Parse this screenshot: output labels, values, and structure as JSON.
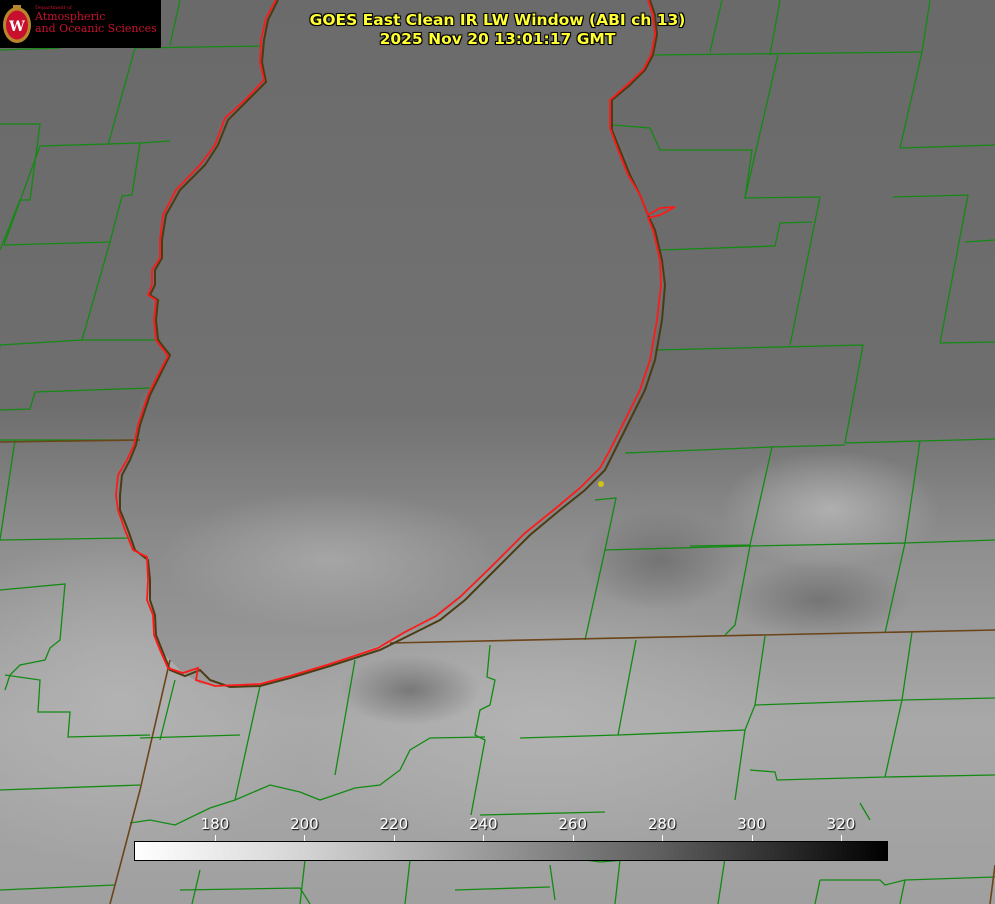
{
  "title": {
    "line1": "GOES East Clean IR LW Window (ABI ch 13)",
    "line2": "2025 Nov 20 13:01:17 GMT"
  },
  "logo": {
    "department": "Department of",
    "line1": "Atmospheric",
    "line2": "and Oceanic Sciences",
    "seal_letter": "W"
  },
  "colorbar": {
    "ticks": [
      {
        "label": "180",
        "value": 180
      },
      {
        "label": "200",
        "value": 200
      },
      {
        "label": "220",
        "value": 220
      },
      {
        "label": "240",
        "value": 240
      },
      {
        "label": "260",
        "value": 260
      },
      {
        "label": "280",
        "value": 280
      },
      {
        "label": "300",
        "value": 300
      },
      {
        "label": "320",
        "value": 320
      }
    ],
    "colors": {
      "low": "#ffffff",
      "high": "#000000"
    }
  },
  "colors": {
    "county_lines": "#138a13",
    "coastline_red": "#ff1a1a",
    "coastline_dark": "#5a3a10",
    "marker": "#d4c21a",
    "title_text": "#ffff33"
  }
}
